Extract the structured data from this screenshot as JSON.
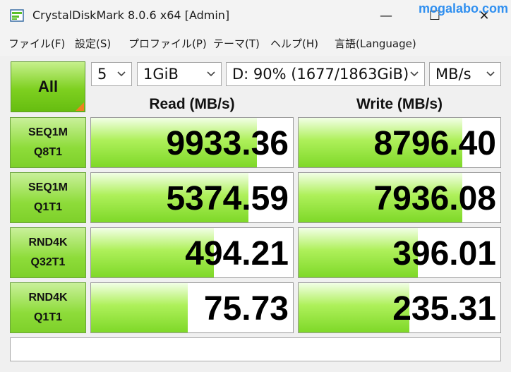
{
  "window": {
    "title": "CrystalDiskMark 8.0.6 x64 [Admin]",
    "minimize_glyph": "—",
    "maximize_glyph": "☐",
    "close_glyph": "✕",
    "watermark": "mogalabo.com"
  },
  "menu": [
    {
      "label": "ファイル(F)"
    },
    {
      "label": "設定(S)"
    },
    {
      "label": "プロファイル(P)"
    },
    {
      "label": "テーマ(T)"
    },
    {
      "label": "ヘルプ(H)"
    },
    {
      "label": "言語(Language)"
    }
  ],
  "controls": {
    "all_label": "All",
    "count": "5",
    "size": "1GiB",
    "drive": "D: 90% (1677/1863GiB)",
    "unit": "MB/s"
  },
  "headers": {
    "read": "Read (MB/s)",
    "write": "Write (MB/s)"
  },
  "tests": [
    {
      "line1": "SEQ1M",
      "line2": "Q8T1",
      "read": "9933.36",
      "write": "8796.40",
      "read_fill": 0.82,
      "write_fill": 0.81
    },
    {
      "line1": "SEQ1M",
      "line2": "Q1T1",
      "read": "5374.59",
      "write": "7936.08",
      "read_fill": 0.78,
      "write_fill": 0.81
    },
    {
      "line1": "RND4K",
      "line2": "Q32T1",
      "read": "494.21",
      "write": "396.01",
      "read_fill": 0.61,
      "write_fill": 0.59
    },
    {
      "line1": "RND4K",
      "line2": "Q1T1",
      "read": "75.73",
      "write": "235.31",
      "read_fill": 0.48,
      "write_fill": 0.55
    }
  ],
  "status_text": "",
  "colors": {
    "accent_green": "#7ed020",
    "corner_orange": "#f08020",
    "watermark_blue": "#2f8ff0"
  }
}
